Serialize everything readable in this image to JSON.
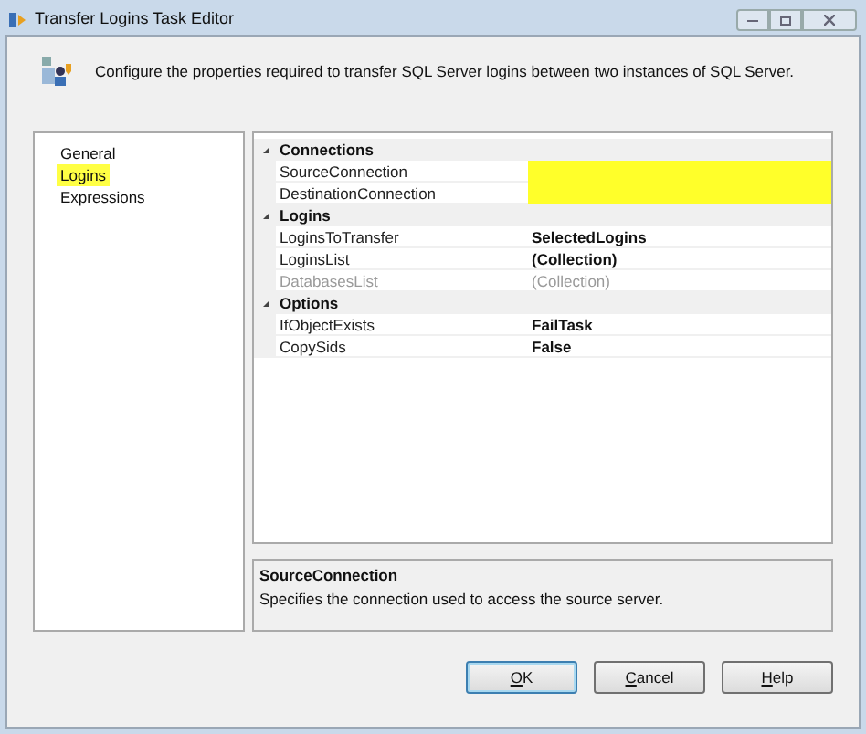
{
  "window": {
    "title": "Transfer Logins Task Editor"
  },
  "header": {
    "text": "Configure the properties required to transfer SQL Server logins between two instances of SQL Server."
  },
  "pages": [
    {
      "label": "General",
      "selected": false
    },
    {
      "label": "Logins",
      "selected": true
    },
    {
      "label": "Expressions",
      "selected": false
    }
  ],
  "property_grid": {
    "categories": [
      {
        "name": "Connections",
        "expanded": true,
        "properties": [
          {
            "name": "SourceConnection",
            "highlighted": true,
            "disabled": false
          },
          {
            "name": "DestinationConnection",
            "highlighted": true,
            "disabled": false
          }
        ]
      },
      {
        "name": "Logins",
        "expanded": true,
        "properties": [
          {
            "name": "LoginsToTransfer",
            "value": "SelectedLogins",
            "highlighted": false,
            "disabled": false
          },
          {
            "name": "LoginsList",
            "value": "(Collection)",
            "highlighted": false,
            "disabled": false
          },
          {
            "name": "DatabasesList",
            "value": "(Collection)",
            "highlighted": false,
            "disabled": true
          }
        ]
      },
      {
        "name": "Options",
        "expanded": true,
        "properties": [
          {
            "name": "IfObjectExists",
            "value": "FailTask",
            "highlighted": false,
            "disabled": false
          },
          {
            "name": "CopySids",
            "value": "False",
            "highlighted": false,
            "disabled": false
          }
        ]
      }
    ]
  },
  "description": {
    "title": "SourceConnection",
    "text": "Specifies the connection used to access the source server."
  },
  "buttons": [
    {
      "label": "OK",
      "default": true
    },
    {
      "label": "Cancel",
      "default": false
    },
    {
      "label": "Help",
      "default": false
    }
  ]
}
